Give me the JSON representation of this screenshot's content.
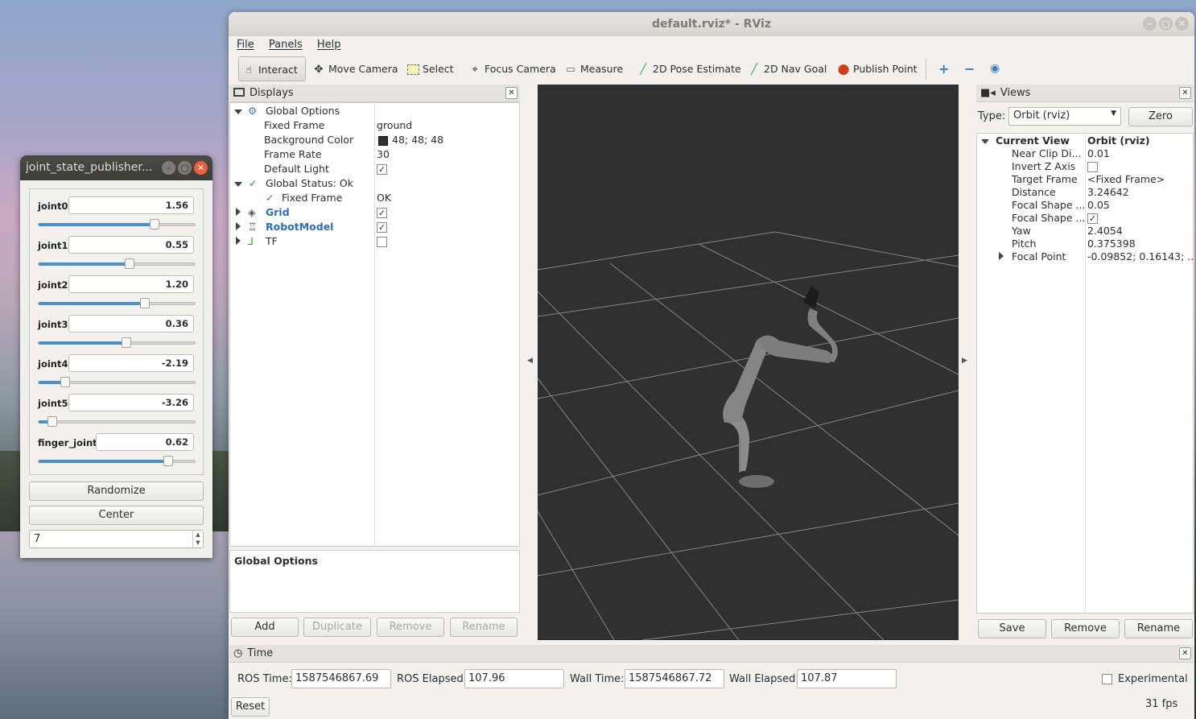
{
  "jsp": {
    "title": "joint_state_publisher...",
    "joints": [
      {
        "name": "joint0",
        "value": "1.56",
        "fraction": 0.74
      },
      {
        "name": "joint1",
        "value": "0.55",
        "fraction": 0.58
      },
      {
        "name": "joint2",
        "value": "1.20",
        "fraction": 0.68
      },
      {
        "name": "joint3",
        "value": "0.36",
        "fraction": 0.56
      },
      {
        "name": "joint4",
        "value": "-2.19",
        "fraction": 0.17
      },
      {
        "name": "joint5",
        "value": "-3.26",
        "fraction": 0.09
      },
      {
        "name": "finger_joint",
        "value": "0.62",
        "fraction": 0.83
      }
    ],
    "randomize_label": "Randomize",
    "center_label": "Center",
    "spin_value": "7"
  },
  "rviz": {
    "title": "default.rviz* - RViz",
    "menu": [
      "File",
      "Panels",
      "Help"
    ],
    "toolbar": {
      "interact": "Interact",
      "move_camera": "Move Camera",
      "select": "Select",
      "focus_camera": "Focus Camera",
      "measure": "Measure",
      "pose_estimate": "2D Pose Estimate",
      "nav_goal": "2D Nav Goal",
      "publish_point": "Publish Point"
    },
    "displays": {
      "title": "Displays",
      "global_options": "Global Options",
      "fixed_frame_label": "Fixed Frame",
      "fixed_frame_value": "ground",
      "bg_color_label": "Background Color",
      "bg_color_value": "48; 48; 48",
      "bg_color_hex": "#303030",
      "frame_rate_label": "Frame Rate",
      "frame_rate_value": "30",
      "default_light_label": "Default Light",
      "global_status": "Global Status: Ok",
      "gs_fixed_frame": "Fixed Frame",
      "gs_fixed_frame_value": "OK",
      "grid": "Grid",
      "robot_model": "RobotModel",
      "tf": "TF",
      "description_title": "Global Options",
      "add": "Add",
      "duplicate": "Duplicate",
      "remove": "Remove",
      "rename": "Rename"
    },
    "views": {
      "title": "Views",
      "type_label": "Type:",
      "type_value": "Orbit (rviz)",
      "zero": "Zero",
      "current_view": "Current View",
      "current_view_value": "Orbit (rviz)",
      "props": [
        {
          "name": "Near Clip Di...",
          "value": "0.01"
        },
        {
          "name": "Invert Z Axis",
          "value": ""
        },
        {
          "name": "Target Frame",
          "value": "<Fixed Frame>"
        },
        {
          "name": "Distance",
          "value": "3.24642"
        },
        {
          "name": "Focal Shape ...",
          "value": "0.05"
        },
        {
          "name": "Focal Shape ...",
          "value": ""
        },
        {
          "name": "Yaw",
          "value": "2.4054"
        },
        {
          "name": "Pitch",
          "value": "0.375398"
        },
        {
          "name": "Focal Point",
          "value": "-0.09852; 0.16143; ..."
        }
      ],
      "save": "Save",
      "remove": "Remove",
      "rename": "Rename"
    },
    "time": {
      "title": "Time",
      "ros_time_label": "ROS Time:",
      "ros_time": "1587546867.69",
      "ros_elapsed_label": "ROS Elapsed:",
      "ros_elapsed": "107.96",
      "wall_time_label": "Wall Time:",
      "wall_time": "1587546867.72",
      "wall_elapsed_label": "Wall Elapsed:",
      "wall_elapsed": "107.87",
      "experimental": "Experimental",
      "reset": "Reset",
      "fps": "31 fps"
    }
  }
}
